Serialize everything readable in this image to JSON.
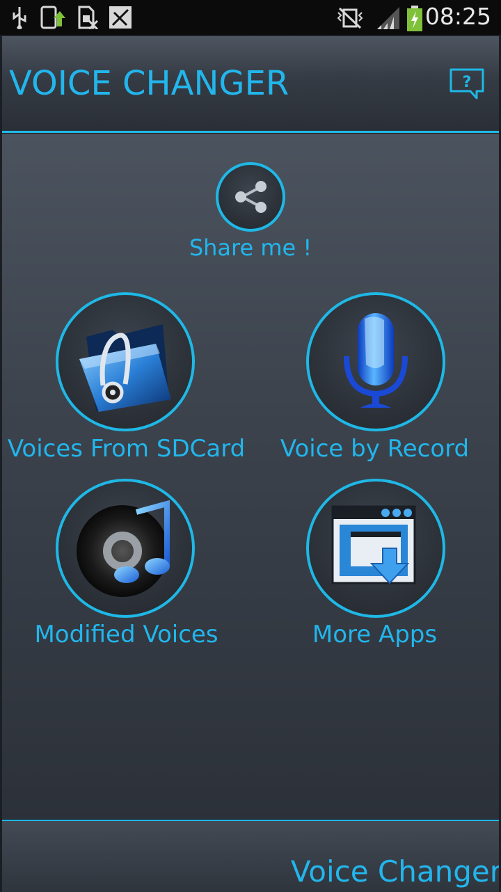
{
  "status_bar": {
    "time": "08:25",
    "icons": [
      "usb-icon",
      "phone-upload-icon",
      "sim-blocked-icon",
      "no-signal-notification-icon",
      "vibrate-muted-icon",
      "signal-icon",
      "battery-charging-icon"
    ]
  },
  "header": {
    "title": "VOICE CHANGER",
    "help_icon": "help-icon"
  },
  "main": {
    "share": {
      "label": "Share me !",
      "icon": "share-icon"
    },
    "buttons": [
      {
        "label": "Voices From SDCard",
        "icon": "folder-headphones-icon"
      },
      {
        "label": "Voice by Record",
        "icon": "microphone-icon"
      },
      {
        "label": "Modified Voices",
        "icon": "music-disc-icon"
      },
      {
        "label": "More Apps",
        "icon": "app-download-icon"
      }
    ]
  },
  "footer": {
    "label": "Voice Changer"
  },
  "colors": {
    "accent": "#1fb8e6",
    "text_accent": "#22b6ec",
    "status_bg": "#0b0b0b"
  }
}
